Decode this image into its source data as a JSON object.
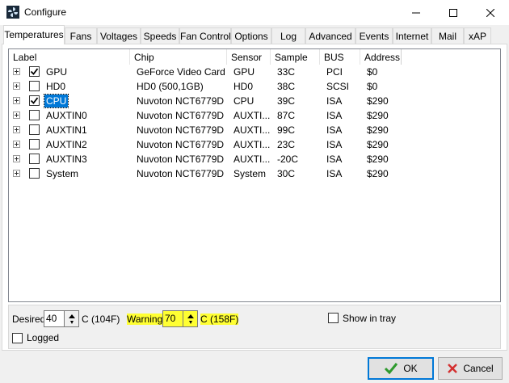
{
  "window": {
    "title": "Configure"
  },
  "tabs": [
    "Temperatures",
    "Fans",
    "Voltages",
    "Speeds",
    "Fan Control",
    "Options",
    "Log",
    "Advanced",
    "Events",
    "Internet",
    "Mail",
    "xAP"
  ],
  "columns": [
    "Label",
    "Chip",
    "Sensor",
    "Sample",
    "BUS",
    "Address"
  ],
  "rows": [
    {
      "label": "GPU",
      "checked": true,
      "chip": "GeForce Video Card",
      "sensor": "GPU",
      "sample": "33C",
      "bus": "PCI",
      "address": "$0"
    },
    {
      "label": "HD0",
      "checked": false,
      "chip": "HD0 (500,1GB)",
      "sensor": "HD0",
      "sample": "38C",
      "bus": "SCSI",
      "address": "$0"
    },
    {
      "label": "CPU",
      "checked": true,
      "selected": true,
      "chip": "Nuvoton NCT6779D",
      "sensor": "CPU",
      "sample": "39C",
      "bus": "ISA",
      "address": "$290"
    },
    {
      "label": "AUXTIN0",
      "checked": false,
      "chip": "Nuvoton NCT6779D",
      "sensor": "AUXTI...",
      "sample": "87C",
      "bus": "ISA",
      "address": "$290"
    },
    {
      "label": "AUXTIN1",
      "checked": false,
      "chip": "Nuvoton NCT6779D",
      "sensor": "AUXTI...",
      "sample": "99C",
      "bus": "ISA",
      "address": "$290"
    },
    {
      "label": "AUXTIN2",
      "checked": false,
      "chip": "Nuvoton NCT6779D",
      "sensor": "AUXTI...",
      "sample": "23C",
      "bus": "ISA",
      "address": "$290"
    },
    {
      "label": "AUXTIN3",
      "checked": false,
      "chip": "Nuvoton NCT6779D",
      "sensor": "AUXTI...",
      "sample": "-20C",
      "bus": "ISA",
      "address": "$290"
    },
    {
      "label": "System",
      "checked": false,
      "chip": "Nuvoton NCT6779D",
      "sensor": "System",
      "sample": "30C",
      "bus": "ISA",
      "address": "$290"
    }
  ],
  "settings": {
    "desired_label": "Desired",
    "desired_value": "40",
    "desired_unit": "C (104F)",
    "warning_label": "Warning",
    "warning_value": "70",
    "warning_unit": "C (158F)",
    "show_in_tray_label": "Show in tray",
    "show_in_tray_checked": false,
    "logged_label": "Logged",
    "logged_checked": false
  },
  "buttons": {
    "ok": "OK",
    "cancel": "Cancel"
  },
  "colors": {
    "selection": "#0078d7",
    "highlight": "#ffff33",
    "ok_check": "#2e9a2e",
    "cancel_x": "#d32f2f"
  }
}
